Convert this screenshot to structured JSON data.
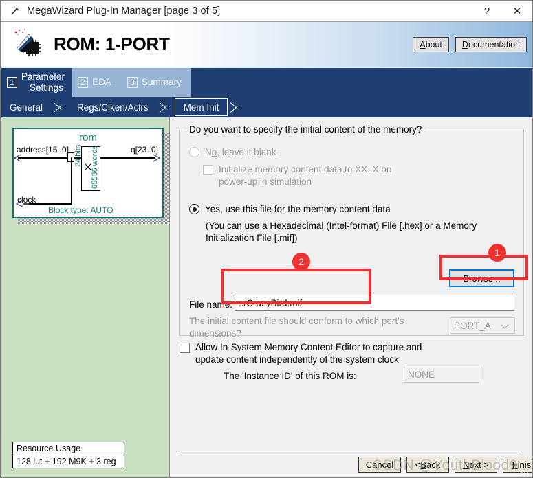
{
  "window": {
    "title": "MegaWizard Plug-In Manager [page 3 of 5]",
    "icon": "wizard-wand-icon",
    "help_label": "?",
    "close_label": "✕"
  },
  "banner": {
    "icon": "rom-chip-icon",
    "title": "ROM: 1-PORT",
    "about_label": "About",
    "about_label_pre": "A",
    "about_label_post": "bout",
    "documentation_label": "Documentation",
    "documentation_pre": "D",
    "documentation_post": "ocumentation"
  },
  "tabs": {
    "main": [
      {
        "num": "1",
        "label": "Parameter Settings",
        "line1": "Parameter",
        "line2": "Settings",
        "active": true
      },
      {
        "num": "2",
        "label": "EDA",
        "line1": "EDA",
        "line2": "",
        "active": false
      },
      {
        "num": "3",
        "label": "Summary",
        "line1": "Summary",
        "line2": "",
        "active": false
      }
    ],
    "sub": [
      {
        "label": "General",
        "selected": false
      },
      {
        "label": "Regs/Clken/Aclrs",
        "selected": false
      },
      {
        "label": "Mem Init",
        "selected": true
      }
    ]
  },
  "symbol": {
    "name": "rom",
    "input_address": "address[15..0]",
    "input_clock": "clock",
    "output_q": "q[23..0]",
    "mem_bits": "24 bits",
    "mem_words": "65536 words",
    "block_type": "Block type: AUTO"
  },
  "resource": {
    "header": "Resource Usage",
    "value": "128 lut + 192 M9K + 3 reg"
  },
  "memory_group": {
    "title": "Do you want to specify the initial content of the memory?",
    "option_no_pre": "N",
    "option_no_underlined": "o",
    "option_no_post": ", leave it blank",
    "option_no_label": "No, leave it blank",
    "option_no_selected": false,
    "init_checkbox_line1": "Initialize memory content data to XX..X on",
    "init_checkbox_line2": "power-up in simulation",
    "init_checkbox_checked": false,
    "option_yes_label": "Yes, use this file for the memory content data",
    "option_yes_selected": true,
    "hint_line1": "(You can use a Hexadecimal (Intel-format) File [.hex] or a Memory",
    "hint_line2": "Initialization File [.mif])",
    "browse_label": "Browse...",
    "file_name_label": "File name:",
    "file_name_value": "../CrazyBird.mif",
    "conform_line1": "The initial content file should conform to which port's",
    "conform_line2": "dimensions?",
    "port_value": "PORT_A"
  },
  "insystem": {
    "checkbox_line1": "Allow In-System Memory Content Editor to capture and",
    "checkbox_line2": "update content independently of the system clock",
    "checkbox_checked": false,
    "instance_label": "The 'Instance ID' of this ROM is:",
    "instance_value": "NONE"
  },
  "annotations": [
    {
      "id": "1",
      "target": "browse-button"
    },
    {
      "id": "2",
      "target": "file-name-input"
    }
  ],
  "footer": {
    "cancel_label": "Cancel",
    "back_label": "< Back",
    "back_pre": "< ",
    "back_u": "B",
    "back_post": "ack",
    "next_pre": "",
    "next_u": "N",
    "next_post": "ext >",
    "next_label": "Next >",
    "finish_u": "F",
    "finish_post": "inish",
    "finish_label": "Finish"
  },
  "watermark": {
    "text": "CSDN @YouthBlood9"
  },
  "colors": {
    "tab_dark_blue": "#1f3f72",
    "tab_light_blue": "#9ab4d4",
    "left_panel_green": "#c9e0c2",
    "symbol_teal": "#137a77",
    "annotation_red": "#f03030",
    "focus_blue": "#0078d7"
  }
}
